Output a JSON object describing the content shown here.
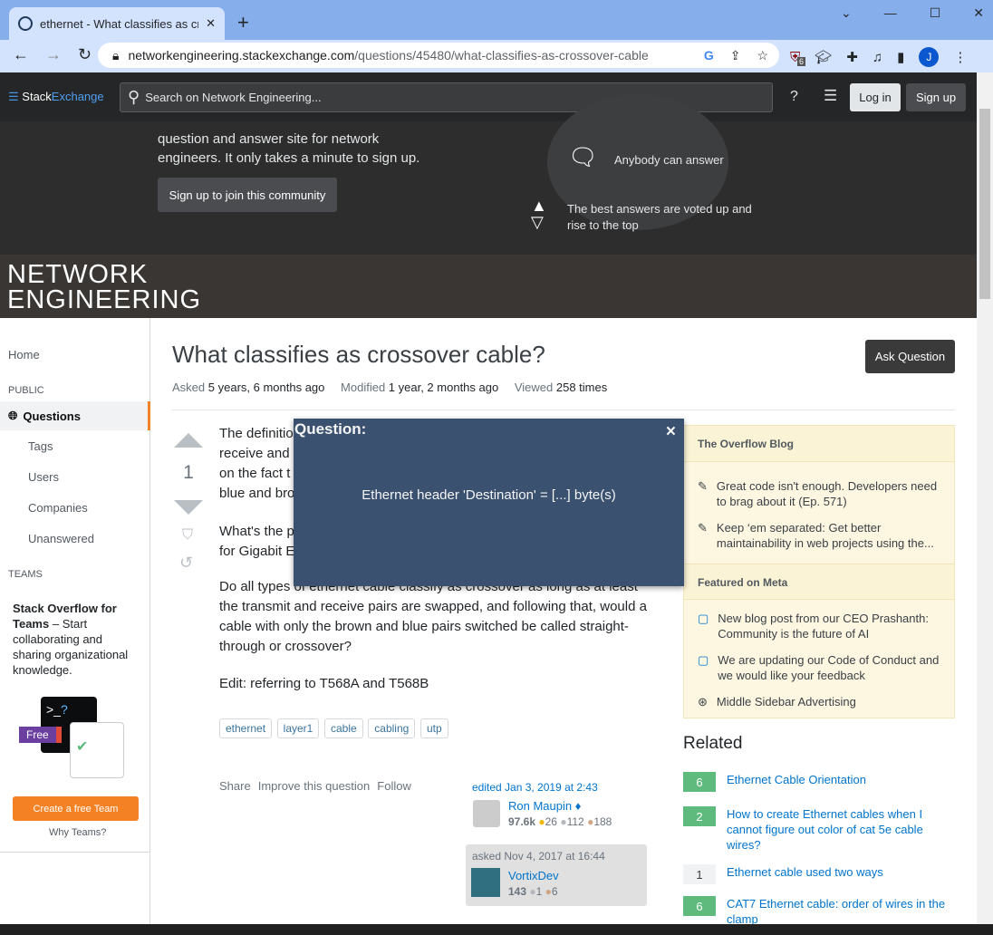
{
  "browser": {
    "tab_title": "ethernet - What classifies as cross",
    "url_host": "networkengineering.stackexchange.com",
    "url_path": "/questions/45480/what-classifies-as-crossover-cable",
    "ext_badge": "6",
    "profile": "J"
  },
  "header": {
    "logo_a": "Stack",
    "logo_b": "Exchange",
    "search_placeholder": "Search on Network Engineering...",
    "login": "Log in",
    "signup": "Sign up"
  },
  "hero": {
    "text1": "question and answer site for network",
    "text2": "engineers. It only takes a minute to sign up.",
    "join": "Sign up to join this community",
    "f1": "Anybody can answer",
    "f2a": "The best answers are voted up and",
    "f2b": "rise to the top"
  },
  "banner": {
    "line1": "NETWORK",
    "line2": "ENGINEERING"
  },
  "nav": {
    "home": "Home",
    "public": "PUBLIC",
    "questions": "Questions",
    "tags": "Tags",
    "users": "Users",
    "companies": "Companies",
    "unanswered": "Unanswered",
    "teams": "TEAMS",
    "teams_title": "Stack Overflow for Teams",
    "teams_desc": " – Start collaborating and sharing organizational knowledge.",
    "free": "Free",
    "create_team": "Create a free Team",
    "why": "Why Teams?"
  },
  "question": {
    "title": "What classifies as crossover cable?",
    "ask": "Ask Question",
    "asked_l": "Asked",
    "asked": "5 years, 6 months ago",
    "mod_l": "Modified",
    "mod": "1 year, 2 months ago",
    "view_l": "Viewed",
    "views": "258 times",
    "votes": "1",
    "p1": [
      "The definitio",
      "receive and t",
      "on the fact t",
      "blue and bro"
    ],
    "p2": [
      "What's the p",
      "for Gigabit E"
    ],
    "p3": "Do all types of ethernet cable classify as crossover as long as at least the transmit and receive pairs are swapped, and following that, would a cable with only the brown and blue pairs switched be called straight-through or crossover?",
    "p4": "Edit: referring to T568A and T568B",
    "tags": [
      "ethernet",
      "layer1",
      "cable",
      "cabling",
      "utp"
    ],
    "share": "Share",
    "improve": "Improve this question",
    "follow": "Follow",
    "edited": "edited Jan 3, 2019 at 2:43",
    "editor": "Ron Maupin",
    "editor_rep": "97.6k",
    "editor_badges": [
      "26",
      "112",
      "188"
    ],
    "asked_full": "asked Nov 4, 2017 at 16:44",
    "author": "VortixDev",
    "author_rep": "143",
    "author_badges": [
      "1",
      "6"
    ]
  },
  "sidebar": {
    "blog_h": "The Overflow Blog",
    "blog": [
      "Great code isn't enough. Developers need to brag about it (Ep. 571)",
      "Keep ‘em separated: Get better maintainability in web projects using the..."
    ],
    "meta_h": "Featured on Meta",
    "meta": [
      "New blog post from our CEO Prashanth: Community is the future of AI",
      "We are updating our Code of Conduct and we would like your feedback",
      "Middle Sidebar Advertising"
    ]
  },
  "related": {
    "title": "Related",
    "items": [
      {
        "n": "6",
        "t": "Ethernet Cable Orientation",
        "a": true
      },
      {
        "n": "2",
        "t": "How to create Ethernet cables when I cannot figure out color of cat 5e cable wires?",
        "a": true
      },
      {
        "n": "1",
        "t": "Ethernet cable used two ways",
        "a": false
      },
      {
        "n": "6",
        "t": "CAT7 Ethernet cable: order of wires in the clamp",
        "a": true
      }
    ]
  },
  "modal": {
    "title": "Question:",
    "text": "Ethernet header 'Destination' = [...] byte(s)",
    "close": "×"
  }
}
